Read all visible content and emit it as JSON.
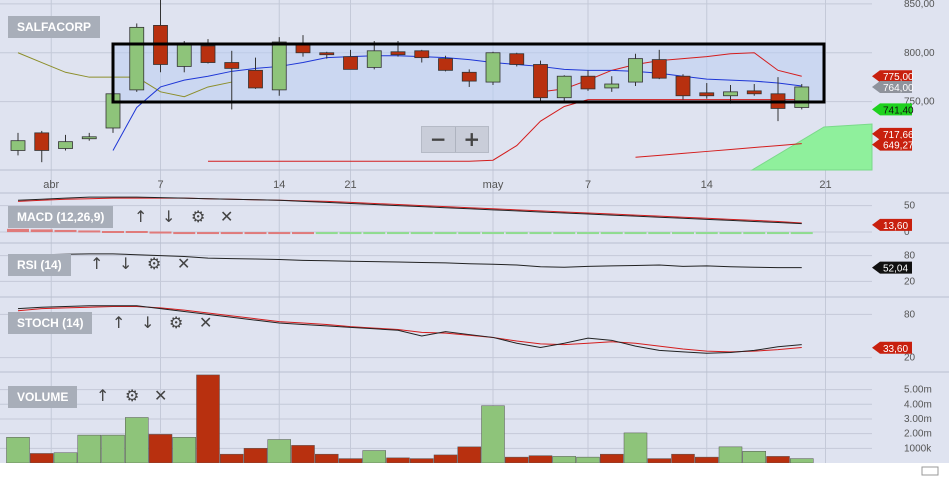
{
  "symbol": "SALFACORP",
  "panels": {
    "macd": {
      "label": "MACD (12,26,9)"
    },
    "rsi": {
      "label": "RSI (14)"
    },
    "stoch": {
      "label": "STOCH (14)"
    },
    "volume": {
      "label": "VOLUME"
    }
  },
  "controls": {
    "zoom_out": "−",
    "zoom_in": "+",
    "up": "↑",
    "down": "↓",
    "settings": "⚙",
    "close": "✕"
  },
  "colors": {
    "up": "#8ec47a",
    "down": "#b8300f",
    "bg": "#dfe3f0",
    "grid": "#c4c9d8"
  },
  "chart_data": {
    "type": "candlestick",
    "x_ticks": [
      {
        "label": "abr",
        "i": 1.4
      },
      {
        "label": "7",
        "i": 6
      },
      {
        "label": "14",
        "i": 11
      },
      {
        "label": "21",
        "i": 14
      },
      {
        "label": "may",
        "i": 20
      },
      {
        "label": "7",
        "i": 24
      },
      {
        "label": "14",
        "i": 29
      },
      {
        "label": "21",
        "i": 34
      }
    ],
    "price": {
      "ylim": [
        680,
        854
      ],
      "ticks": [
        {
          "label": "850,00",
          "v": 850
        },
        {
          "label": "800,00",
          "v": 800
        },
        {
          "label": "750,00",
          "v": 750
        }
      ],
      "badges": [
        {
          "label": "775,00",
          "v": 776,
          "color": "#c8200e",
          "text": "#ffffff"
        },
        {
          "label": "764,00",
          "v": 765,
          "color": "#8f939c",
          "text": "#ffffff"
        },
        {
          "label": "741,40",
          "v": 742,
          "color": "#1ed21e",
          "text": "#111111"
        },
        {
          "label": "717,66",
          "v": 717,
          "color": "#c8200e",
          "text": "#ffffff"
        },
        {
          "label": "649,27",
          "v": 706,
          "color": "#c8200e",
          "text": "#ffffff"
        }
      ],
      "candles": [
        {
          "o": 700,
          "h": 718,
          "l": 695,
          "c": 710
        },
        {
          "o": 718,
          "h": 720,
          "l": 688,
          "c": 700
        },
        {
          "o": 702,
          "h": 716,
          "l": 700,
          "c": 709
        },
        {
          "o": 712,
          "h": 718,
          "l": 710,
          "c": 714
        },
        {
          "o": 723,
          "h": 762,
          "l": 718,
          "c": 758
        },
        {
          "o": 762,
          "h": 830,
          "l": 760,
          "c": 826
        },
        {
          "o": 828,
          "h": 855,
          "l": 780,
          "c": 788
        },
        {
          "o": 786,
          "h": 812,
          "l": 780,
          "c": 810
        },
        {
          "o": 807,
          "h": 814,
          "l": 789,
          "c": 790
        },
        {
          "o": 790,
          "h": 802,
          "l": 742,
          "c": 784
        },
        {
          "o": 782,
          "h": 795,
          "l": 763,
          "c": 764
        },
        {
          "o": 762,
          "h": 816,
          "l": 756,
          "c": 811
        },
        {
          "o": 810,
          "h": 818,
          "l": 796,
          "c": 800
        },
        {
          "o": 800,
          "h": 801,
          "l": 794,
          "c": 798
        },
        {
          "o": 796,
          "h": 803,
          "l": 783,
          "c": 783
        },
        {
          "o": 785,
          "h": 812,
          "l": 783,
          "c": 802
        },
        {
          "o": 801,
          "h": 812,
          "l": 796,
          "c": 798
        },
        {
          "o": 802,
          "h": 803,
          "l": 790,
          "c": 795
        },
        {
          "o": 794,
          "h": 797,
          "l": 781,
          "c": 782
        },
        {
          "o": 780,
          "h": 783,
          "l": 765,
          "c": 771
        },
        {
          "o": 770,
          "h": 801,
          "l": 767,
          "c": 800
        },
        {
          "o": 799,
          "h": 800,
          "l": 786,
          "c": 788
        },
        {
          "o": 788,
          "h": 792,
          "l": 750,
          "c": 754
        },
        {
          "o": 754,
          "h": 777,
          "l": 751,
          "c": 776
        },
        {
          "o": 776,
          "h": 782,
          "l": 761,
          "c": 763
        },
        {
          "o": 764,
          "h": 776,
          "l": 760,
          "c": 768
        },
        {
          "o": 770,
          "h": 799,
          "l": 766,
          "c": 794
        },
        {
          "o": 793,
          "h": 803,
          "l": 773,
          "c": 774
        },
        {
          "o": 776,
          "h": 778,
          "l": 752,
          "c": 756
        },
        {
          "o": 759,
          "h": 769,
          "l": 753,
          "c": 756
        },
        {
          "o": 756,
          "h": 767,
          "l": 748,
          "c": 760
        },
        {
          "o": 761,
          "h": 768,
          "l": 756,
          "c": 758
        },
        {
          "o": 758,
          "h": 775,
          "l": 730,
          "c": 743
        },
        {
          "o": 744,
          "h": 768,
          "l": 742,
          "c": 765
        }
      ],
      "sma": [
        null,
        null,
        null,
        null,
        700,
        744,
        765,
        772,
        776,
        781,
        784,
        786,
        790,
        795,
        796,
        797,
        797,
        796,
        795,
        793,
        790,
        788,
        786,
        783,
        782,
        782,
        781,
        779,
        776,
        773,
        772,
        771,
        769,
        766
      ],
      "upper": [
        null,
        null,
        null,
        null,
        null,
        null,
        null,
        null,
        null,
        null,
        null,
        null,
        null,
        null,
        null,
        null,
        null,
        null,
        null,
        null,
        null,
        null,
        760,
        763,
        772,
        782,
        788,
        792,
        794,
        796,
        799,
        800,
        782,
        776
      ],
      "lower": [
        null,
        null,
        null,
        null,
        null,
        null,
        null,
        null,
        689,
        689,
        689,
        689,
        689,
        689,
        689,
        689,
        689,
        689,
        689,
        689,
        690,
        705,
        730,
        745,
        752,
        752,
        752,
        752,
        752,
        752,
        752,
        752,
        752,
        752
      ],
      "lower2": [
        null,
        null,
        null,
        null,
        null,
        null,
        null,
        null,
        null,
        null,
        null,
        null,
        null,
        null,
        null,
        null,
        null,
        null,
        null,
        null,
        null,
        null,
        null,
        null,
        null,
        null,
        693,
        695,
        697,
        699,
        701,
        703,
        705,
        707
      ],
      "olive": [
        800,
        790,
        780,
        775,
        775,
        775,
        760,
        755,
        765,
        770,
        null,
        null,
        null,
        null,
        null,
        null,
        null,
        null,
        null,
        null,
        null,
        null,
        null,
        null,
        null,
        null,
        null,
        null,
        null,
        null,
        null,
        null,
        null,
        null
      ]
    },
    "macd": {
      "ticks": [
        {
          "label": "50",
          "v": 50
        },
        {
          "label": "0",
          "v": 0
        }
      ],
      "badge": {
        "label": "13,60",
        "v": 13.6
      },
      "macd": [
        60,
        62,
        64,
        66,
        66,
        66,
        65,
        64,
        63,
        62,
        61,
        60,
        58,
        56,
        54,
        52,
        50,
        48,
        46,
        44,
        42,
        40,
        38,
        36,
        34,
        32,
        30,
        28,
        26,
        24,
        22,
        20,
        18,
        16
      ],
      "signal": [
        58,
        60,
        62,
        63,
        64,
        64,
        64,
        64,
        63,
        62,
        61,
        60,
        59,
        58,
        56,
        54,
        52,
        50,
        48,
        46,
        44,
        42,
        40,
        38,
        36,
        34,
        32,
        30,
        28,
        26,
        24,
        22,
        20,
        17
      ],
      "hist": [
        6,
        5,
        4,
        3,
        2,
        2,
        1,
        0,
        0,
        0,
        0,
        0,
        0,
        -1,
        -1,
        -1,
        -1,
        -1,
        -1,
        -1,
        -1,
        -1,
        -1,
        -1,
        -1,
        -1,
        -1,
        -1,
        -1,
        -1,
        -1,
        -1,
        -1,
        -1
      ]
    },
    "rsi": {
      "ticks": [
        {
          "label": "80",
          "v": 80
        },
        {
          "label": "20",
          "v": 20
        }
      ],
      "badge": {
        "label": "52,04",
        "v": 52.04
      },
      "values": [
        80,
        82,
        83,
        84,
        84,
        82,
        80,
        78,
        74,
        73,
        72,
        71,
        69,
        68,
        67,
        66,
        65,
        64,
        63,
        61,
        60,
        58,
        54,
        53,
        55,
        56,
        57,
        58,
        55,
        56,
        54,
        53,
        52,
        52
      ]
    },
    "stoch": {
      "ticks": [
        {
          "label": "80",
          "v": 80
        },
        {
          "label": "20",
          "v": 20
        }
      ],
      "badge": {
        "label": "33,60",
        "v": 33.6
      },
      "k": [
        88,
        90,
        91,
        92,
        92,
        92,
        88,
        84,
        80,
        76,
        72,
        68,
        66,
        64,
        62,
        60,
        58,
        50,
        56,
        52,
        48,
        40,
        34,
        40,
        47,
        44,
        36,
        30,
        28,
        26,
        27,
        30,
        35,
        38
      ],
      "d": [
        85,
        88,
        89,
        90,
        91,
        91,
        89,
        86,
        82,
        78,
        74,
        70,
        68,
        66,
        63,
        61,
        59,
        55,
        54,
        51,
        48,
        43,
        39,
        38,
        40,
        42,
        40,
        36,
        32,
        29,
        28,
        29,
        31,
        34
      ]
    },
    "volume": {
      "ticks": [
        "5.00m",
        "4.00m",
        "3.00m",
        "2.00m",
        "1000k"
      ],
      "ymax": 6.2,
      "bars": [
        {
          "v": 1.75,
          "up": true
        },
        {
          "v": 0.65,
          "up": false
        },
        {
          "v": 0.7,
          "up": true
        },
        {
          "v": 1.9,
          "up": true
        },
        {
          "v": 1.9,
          "up": true
        },
        {
          "v": 3.1,
          "up": true
        },
        {
          "v": 1.95,
          "up": false
        },
        {
          "v": 1.75,
          "up": true
        },
        {
          "v": 6.0,
          "up": false
        },
        {
          "v": 0.6,
          "up": false
        },
        {
          "v": 1.0,
          "up": false
        },
        {
          "v": 1.6,
          "up": true
        },
        {
          "v": 1.2,
          "up": false
        },
        {
          "v": 0.6,
          "up": false
        },
        {
          "v": 0.3,
          "up": false
        },
        {
          "v": 0.85,
          "up": true
        },
        {
          "v": 0.35,
          "up": false
        },
        {
          "v": 0.3,
          "up": false
        },
        {
          "v": 0.55,
          "up": false
        },
        {
          "v": 1.1,
          "up": false
        },
        {
          "v": 3.9,
          "up": true
        },
        {
          "v": 0.4,
          "up": false
        },
        {
          "v": 0.5,
          "up": false
        },
        {
          "v": 0.45,
          "up": true
        },
        {
          "v": 0.4,
          "up": true
        },
        {
          "v": 0.6,
          "up": false
        },
        {
          "v": 2.05,
          "up": true
        },
        {
          "v": 0.3,
          "up": false
        },
        {
          "v": 0.6,
          "up": false
        },
        {
          "v": 0.4,
          "up": false
        },
        {
          "v": 1.1,
          "up": true
        },
        {
          "v": 0.8,
          "up": true
        },
        {
          "v": 0.45,
          "up": false
        },
        {
          "v": 0.3,
          "up": true
        }
      ]
    }
  }
}
